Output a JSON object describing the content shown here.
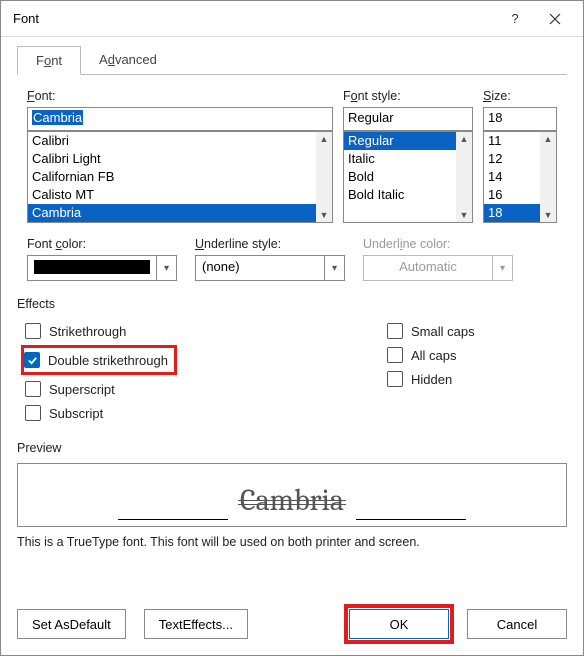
{
  "window": {
    "title": "Font"
  },
  "tabs": {
    "font": "Font",
    "advanced": "Advanced"
  },
  "font": {
    "label_html": "<span class='ul'>F</span>ont:",
    "value": "Cambria",
    "list": [
      "Calibri",
      "Calibri Light",
      "Californian FB",
      "Calisto MT",
      "Cambria"
    ],
    "selected": "Cambria"
  },
  "style": {
    "label_html": "F<span class='ul'>o</span>nt style:",
    "value": "Regular",
    "list": [
      "Regular",
      "Italic",
      "Bold",
      "Bold Italic"
    ],
    "selected": "Regular"
  },
  "size": {
    "label_html": "<span class='ul'>S</span>ize:",
    "value": "18",
    "list": [
      "11",
      "12",
      "14",
      "16",
      "18"
    ],
    "selected": "18"
  },
  "fontcolor": {
    "label_html": "Font <span class='ul'>c</span>olor:",
    "swatch": "#000000"
  },
  "underlinestyle": {
    "label_html": "<span class='ul'>U</span>nderline style:",
    "value": "(none)"
  },
  "underlinecolor": {
    "label_html": "Underl<span class='ul'>i</span>ne color:",
    "value": "Automatic"
  },
  "effects": {
    "title": "Effects",
    "strikethrough": {
      "label_html": "Stri<span class='ul'>k</span>ethrough",
      "checked": false
    },
    "double_strike": {
      "label_html": "Doub<span class='ul'>l</span>e strikethrough",
      "checked": true
    },
    "superscript": {
      "label_html": "Su<span class='ul'>p</span>erscript",
      "checked": false
    },
    "subscript": {
      "label_html": "Su<span class='ul'>b</span>script",
      "checked": false
    },
    "smallcaps": {
      "label_html": "S<span class='ul'>m</span>all caps",
      "checked": false
    },
    "allcaps": {
      "label_html": "<span class='ul'>A</span>ll caps",
      "checked": false
    },
    "hidden": {
      "label_html": "<span class='ul'>H</span>idden",
      "checked": false
    }
  },
  "preview": {
    "title": "Preview",
    "word": "Cambria",
    "hint": "This is a TrueType font. This font will be used on both printer and screen."
  },
  "buttons": {
    "set_default_html": "Set As <span class='ul'>D</span>efault",
    "text_effects_html": "Text <span class='ul'>E</span>ffects...",
    "ok": "OK",
    "cancel": "Cancel"
  }
}
